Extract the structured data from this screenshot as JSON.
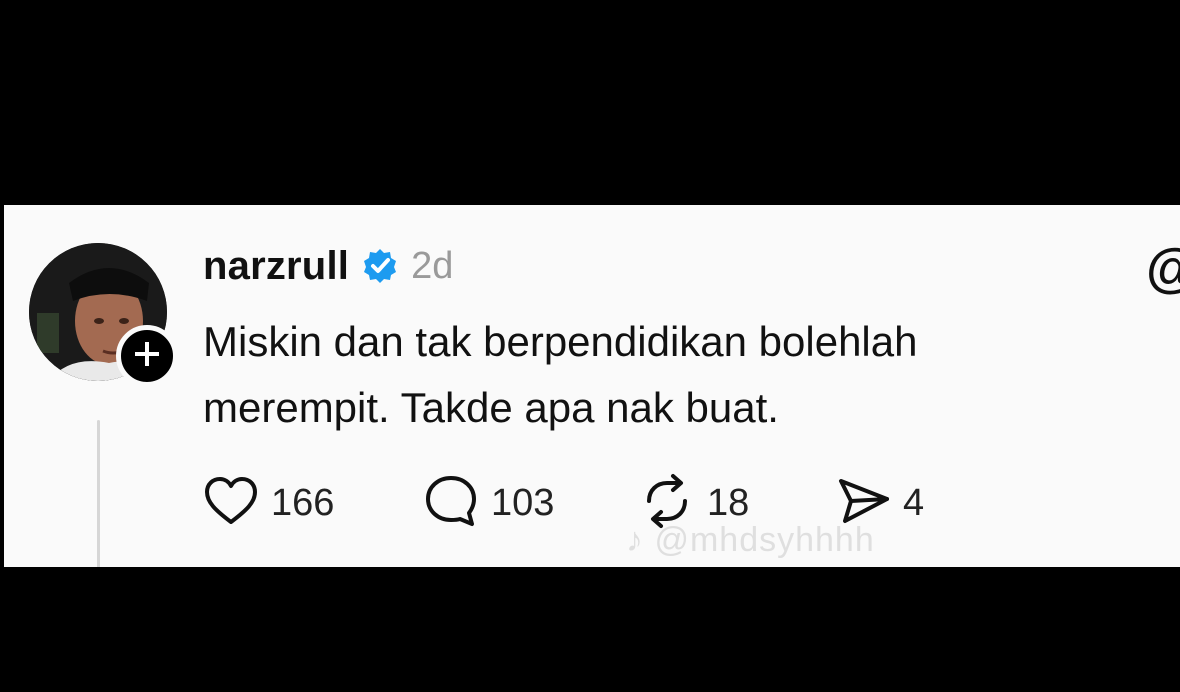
{
  "post": {
    "username": "narzrull",
    "time": "2d",
    "text_line1": "Miskin dan tak berpendidikan bolehlah",
    "text_line2": "merempit. Takde apa nak buat.",
    "verified_color": "#1d9bf0"
  },
  "actions": {
    "likes": "166",
    "replies": "103",
    "reposts": "18",
    "shares": "4"
  },
  "watermark": "@mhdsyhhhh",
  "icons": {
    "more": "more-options-icon",
    "like": "heart-icon",
    "reply": "comment-bubble-icon",
    "repost": "repost-icon",
    "share": "send-icon",
    "follow": "plus-icon",
    "verified": "verified-badge-icon"
  }
}
